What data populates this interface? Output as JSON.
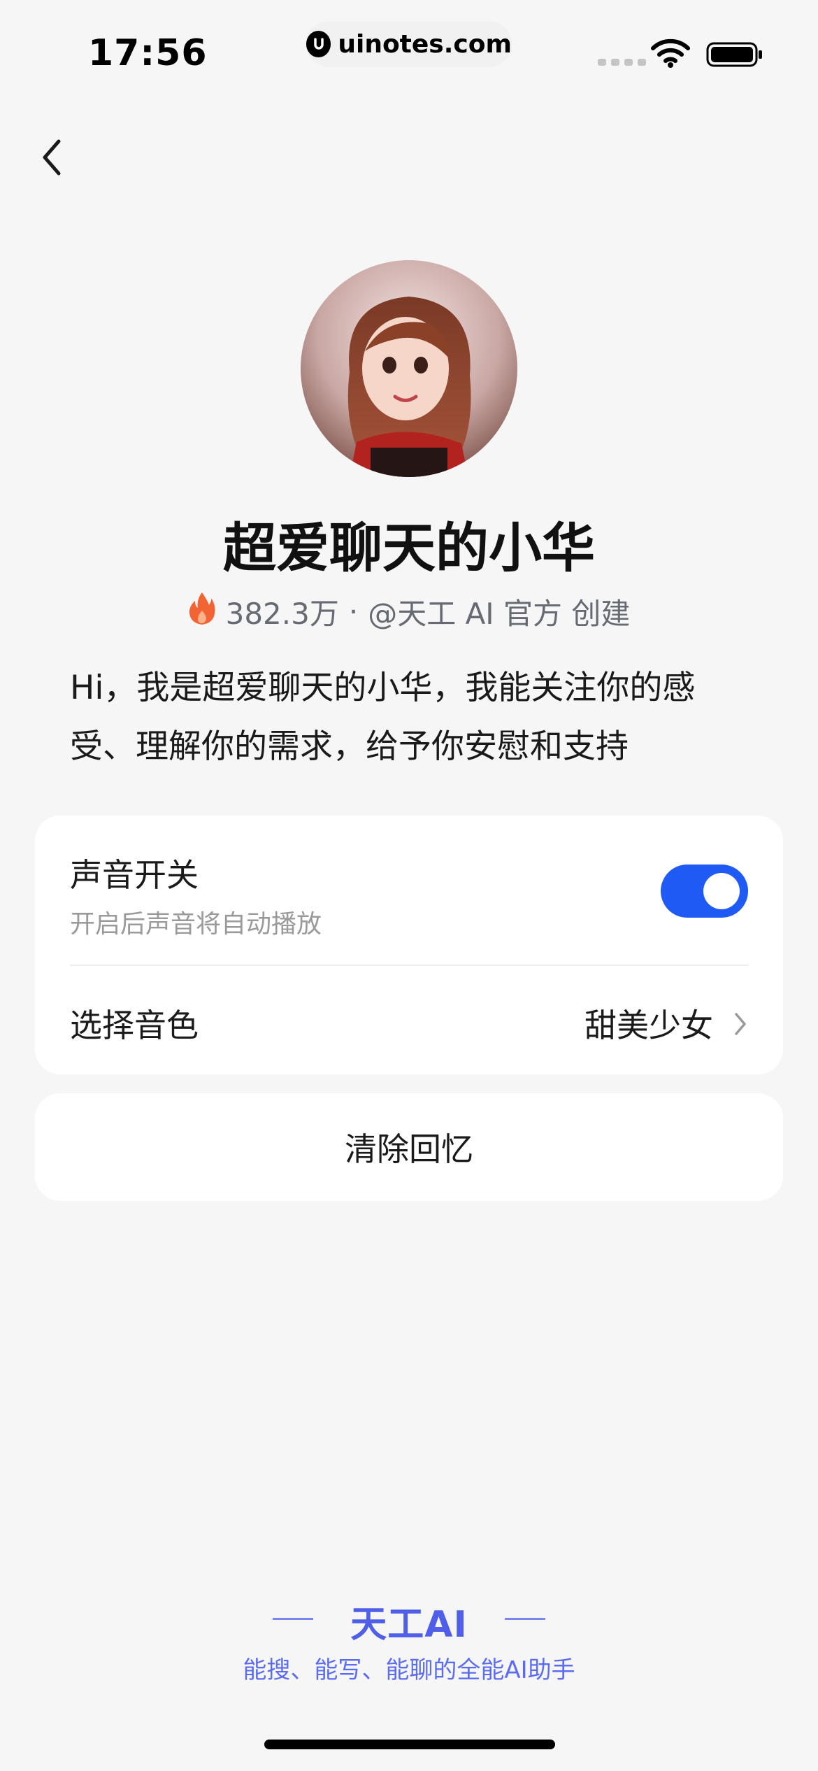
{
  "status_bar": {
    "time": "17:56",
    "url": "uinotes.com",
    "icons": [
      "signal-icon",
      "wifi-icon",
      "battery-icon"
    ]
  },
  "nav": {
    "back_icon": "chevron-left-icon"
  },
  "profile": {
    "name": "超爱聊天的小华",
    "heat_icon": "flame-icon",
    "heat_count": "382.3万",
    "separator": "·",
    "creator": "@天工 AI 官方 创建",
    "description": "Hi，我是超爱聊天的小华，我能关注你的感受、理解你的需求，给予你安慰和支持"
  },
  "settings": {
    "sound_title": "声音开关",
    "sound_subtitle": "开启后声音将自动播放",
    "sound_enabled": true,
    "voice_label": "选择音色",
    "voice_value": "甜美少女"
  },
  "actions": {
    "clear_memory": "清除回忆"
  },
  "footer": {
    "brand": "天工AI",
    "tagline": "能搜、能写、能聊的全能AI助手"
  },
  "colors": {
    "accent": "#1f5af5",
    "brand": "#4f5fe8",
    "background": "#f6f6f6"
  }
}
